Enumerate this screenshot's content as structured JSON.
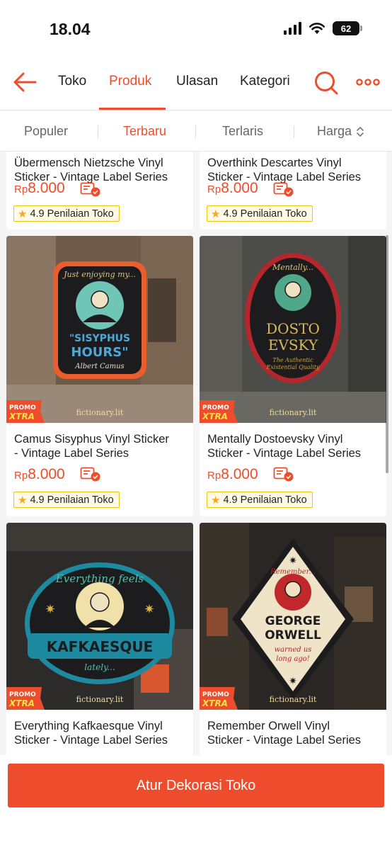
{
  "status_bar": {
    "time": "18.04",
    "battery": "62"
  },
  "nav": {
    "tabs": [
      {
        "label": "Toko"
      },
      {
        "label": "Produk"
      },
      {
        "label": "Ulasan"
      },
      {
        "label": "Kategori"
      }
    ],
    "active_tab": "Produk"
  },
  "sort": {
    "items": [
      {
        "label": "Populer"
      },
      {
        "label": "Terbaru"
      },
      {
        "label": "Terlaris"
      },
      {
        "label": "Harga"
      }
    ],
    "active": "Terbaru"
  },
  "products": [
    {
      "title_line1": "Übermensch Nietzsche Vinyl",
      "title_line2": "Sticker - Vintage Label Series",
      "price_currency": "Rp",
      "price_amount": "8.000",
      "rating": "4.9 Penilaian Toko"
    },
    {
      "title_line1": "Overthink Descartes Vinyl",
      "title_line2": "Sticker - Vintage Label Series",
      "price_currency": "Rp",
      "price_amount": "8.000",
      "rating": "4.9 Penilaian Toko"
    },
    {
      "title_line1": "Camus Sisyphus Vinyl Sticker",
      "title_line2": "- Vintage Label Series",
      "price_currency": "Rp",
      "price_amount": "8.000",
      "rating": "4.9 Penilaian Toko",
      "art": {
        "top": "Just enjoying my...",
        "main1": "\"SISYPHUS",
        "main2": "HOURS\"",
        "sign": "Albert Camus"
      },
      "promo": {
        "l1": "PROMO",
        "l2": "XTRA"
      },
      "watermark": "fictionary.lit"
    },
    {
      "title_line1": "Mentally Dostoevsky Vinyl",
      "title_line2": "Sticker - Vintage Label Series",
      "price_currency": "Rp",
      "price_amount": "8.000",
      "rating": "4.9 Penilaian Toko",
      "art": {
        "top": "Mentally...",
        "main1": "DOSTO",
        "main2": "EVSKY",
        "sub1": "The Authentic",
        "sub2": "Existential Quality"
      },
      "promo": {
        "l1": "PROMO",
        "l2": "XTRA"
      },
      "watermark": "fictionary.lit"
    },
    {
      "title_line1": "Everything Kafkaesque Vinyl",
      "title_line2": "Sticker - Vintage Label Series",
      "art": {
        "top": "Everything feels",
        "main": "KAFKAESQUE",
        "bottom": "lately..."
      },
      "promo": {
        "l1": "PROMO",
        "l2": "XTRA"
      },
      "watermark": "fictionary.lit"
    },
    {
      "title_line1": "Remember Orwell Vinyl",
      "title_line2": "Sticker - Vintage Label Series",
      "art": {
        "top": "Remember...",
        "main1": "GEORGE",
        "main2": "ORWELL",
        "sub1": "warned us",
        "sub2": "long ago!"
      },
      "promo": {
        "l1": "PROMO",
        "l2": "XTRA"
      },
      "watermark": "fictionary.lit"
    }
  ],
  "cta": {
    "label": "Atur Dekorasi Toko"
  },
  "colors": {
    "accent": "#ee4d2d",
    "rating_border": "#f1c40f"
  }
}
